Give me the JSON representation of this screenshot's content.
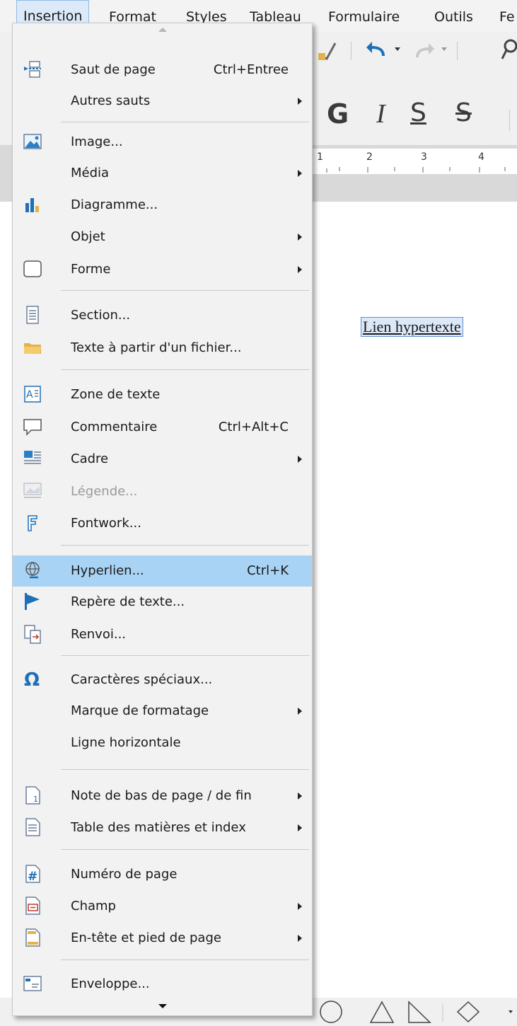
{
  "menubar": {
    "items": [
      {
        "label": "Insertion",
        "active": true
      },
      {
        "label": "Format"
      },
      {
        "label": "Styles"
      },
      {
        "label": "Tableau"
      },
      {
        "label": "Formulaire"
      },
      {
        "label": "Outils"
      },
      {
        "label": "Fe"
      }
    ]
  },
  "toolbar": {
    "bold": "G",
    "italic": "I",
    "underline": "S",
    "strikethrough": "S"
  },
  "ruler": {
    "ticks": [
      "1",
      "2",
      "3",
      "4"
    ]
  },
  "document": {
    "hyperlink_text": "Lien hypertexte"
  },
  "colors": {
    "highlight": "#a9d3f5",
    "menu_bg": "#f2f2f2",
    "active_menu_bg": "#dbe9f9"
  },
  "menu": {
    "items": [
      {
        "id": "saut-de-page",
        "label": "Saut de page",
        "shortcut": "Ctrl+Entree",
        "icon": "page-break-icon"
      },
      {
        "id": "autres-sauts",
        "label": "Autres sauts",
        "submenu": true
      },
      {
        "id": "image",
        "label": "Image...",
        "icon": "image-icon"
      },
      {
        "id": "media",
        "label": "Média",
        "submenu": true
      },
      {
        "id": "diagramme",
        "label": "Diagramme...",
        "icon": "chart-icon"
      },
      {
        "id": "objet",
        "label": "Objet",
        "submenu": true
      },
      {
        "id": "forme",
        "label": "Forme",
        "submenu": true,
        "icon": "shape-icon"
      },
      {
        "id": "section",
        "label": "Section...",
        "icon": "section-icon"
      },
      {
        "id": "texte-fichier",
        "label": "Texte à partir d'un fichier...",
        "icon": "folder-icon"
      },
      {
        "id": "zone-texte",
        "label": "Zone de texte",
        "icon": "text-box-icon"
      },
      {
        "id": "commentaire",
        "label": "Commentaire",
        "shortcut": "Ctrl+Alt+C",
        "icon": "comment-icon"
      },
      {
        "id": "cadre",
        "label": "Cadre",
        "submenu": true,
        "icon": "frame-icon"
      },
      {
        "id": "legende",
        "label": "Légende...",
        "disabled": true,
        "icon": "caption-icon"
      },
      {
        "id": "fontwork",
        "label": "Fontwork...",
        "icon": "fontwork-icon"
      },
      {
        "id": "hyperlien",
        "label": "Hyperlien...",
        "shortcut": "Ctrl+K",
        "highlighted": true,
        "icon": "hyperlink-icon"
      },
      {
        "id": "repere-texte",
        "label": "Repère de texte...",
        "icon": "bookmark-icon"
      },
      {
        "id": "renvoi",
        "label": "Renvoi...",
        "icon": "cross-reference-icon"
      },
      {
        "id": "caracteres-speciaux",
        "label": "Caractères spéciaux...",
        "icon": "omega-icon"
      },
      {
        "id": "marque-formatage",
        "label": "Marque de formatage",
        "submenu": true
      },
      {
        "id": "ligne-horizontale",
        "label": "Ligne horizontale"
      },
      {
        "id": "note-bas-page",
        "label": "Note de bas de page / de fin",
        "submenu": true,
        "icon": "footnote-icon"
      },
      {
        "id": "table-matieres",
        "label": "Table des matières et index",
        "submenu": true,
        "icon": "toc-icon"
      },
      {
        "id": "numero-page",
        "label": "Numéro de page",
        "icon": "page-number-icon"
      },
      {
        "id": "champ",
        "label": "Champ",
        "submenu": true,
        "icon": "field-icon"
      },
      {
        "id": "entete-pied",
        "label": "En-tête et pied de page",
        "submenu": true,
        "icon": "header-footer-icon"
      },
      {
        "id": "enveloppe",
        "label": "Enveloppe...",
        "icon": "envelope-icon"
      }
    ]
  }
}
